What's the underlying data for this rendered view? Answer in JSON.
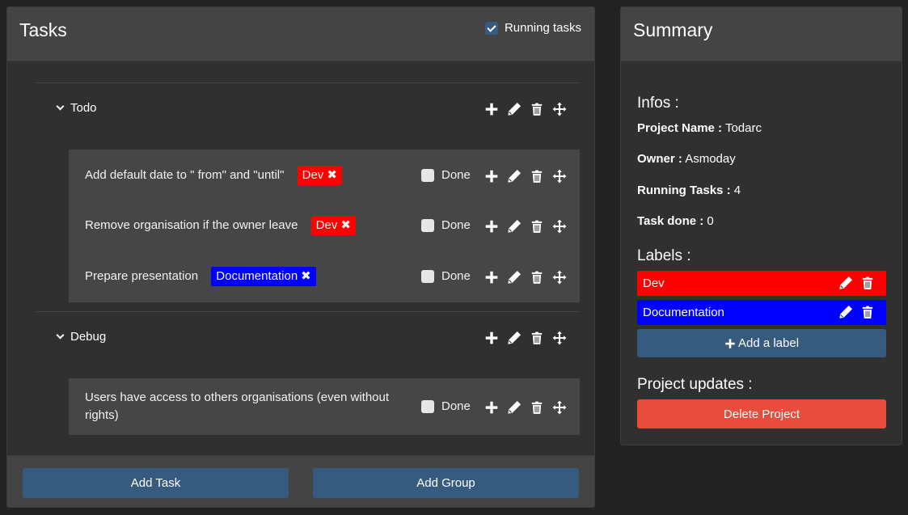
{
  "tasks_panel": {
    "title": "Tasks",
    "running_label": "Running tasks",
    "running_checked": true,
    "groups": [
      {
        "name": "Todo",
        "tasks": [
          {
            "text": "Add default date to \" from\" and \"until\"",
            "tag": "Dev",
            "tag_color": "#ff0000",
            "done_label": "Done"
          },
          {
            "text": "Remove organisation if the owner leave",
            "tag": "Dev",
            "tag_color": "#ff0000",
            "done_label": "Done"
          },
          {
            "text": "Prepare presentation",
            "tag": "Documentation",
            "tag_color": "#0000ff",
            "done_label": "Done"
          }
        ]
      },
      {
        "name": "Debug",
        "tasks": [
          {
            "text": "Users have access to others organisations (even without rights)",
            "tag": "",
            "done_label": "Done"
          }
        ]
      }
    ],
    "add_task_label": "Add Task",
    "add_group_label": "Add Group"
  },
  "summary": {
    "title": "Summary",
    "infos_heading": "Infos :",
    "project_name_label": "Project Name :",
    "project_name": "Todarc",
    "owner_label": "Owner :",
    "owner": "Asmoday",
    "running_label": "Running Tasks :",
    "running_count": "4",
    "done_label": "Task done :",
    "done_count": "0",
    "labels_heading": "Labels :",
    "labels": [
      {
        "name": "Dev",
        "color": "#ff0000"
      },
      {
        "name": "Documentation",
        "color": "#0000ff"
      }
    ],
    "add_label": "Add a label",
    "updates_heading": "Project updates :",
    "delete_label": "Delete Project",
    "delete_color": "#e74c3c"
  },
  "icons": [
    "plus-icon",
    "pencil-icon",
    "trash-icon",
    "move-icon",
    "chevron-down-icon",
    "close-icon",
    "check-icon"
  ]
}
